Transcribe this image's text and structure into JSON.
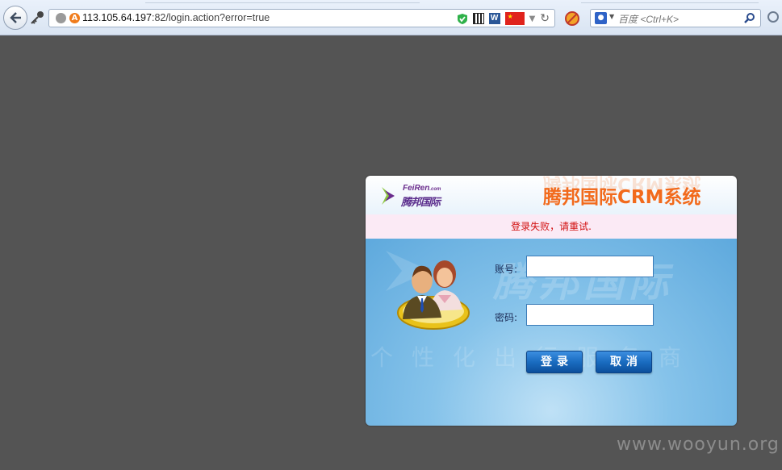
{
  "browser": {
    "url_host": "113.105.64.197",
    "url_rest": ":82/login.action?error=true",
    "search_placeholder": "百度 <Ctrl+K>",
    "engine_icon": "baidu-paw-icon",
    "toolbar_icons": [
      "back-arrow-icon",
      "key-icon",
      "globe-icon",
      "warning-icon",
      "shield-check-icon",
      "qr-code-icon",
      "w-icon",
      "china-flag-icon",
      "dropdown-icon",
      "reload-icon",
      "noscript-icon",
      "search-icon"
    ]
  },
  "login": {
    "logo_en": "FeiRen",
    "logo_en_suffix": ".com",
    "logo_cn": "腾邦国际",
    "title": "腾邦国际CRM系统",
    "error_message": "登录失败，请重试.",
    "account_label": "账号:",
    "password_label": "密码:",
    "account_value": "",
    "password_value": "",
    "login_button": "登录",
    "cancel_button": "取消",
    "watermark_text": "腾邦国际",
    "slogan_text": "个性化出行服务商"
  },
  "page_watermark": "www.wooyun.org",
  "colors": {
    "title_orange": "#f26a1c",
    "error_red": "#d21010",
    "panel_blue": "#5ea9dd",
    "button_blue": "#1a6cc0",
    "background": "#545454"
  }
}
